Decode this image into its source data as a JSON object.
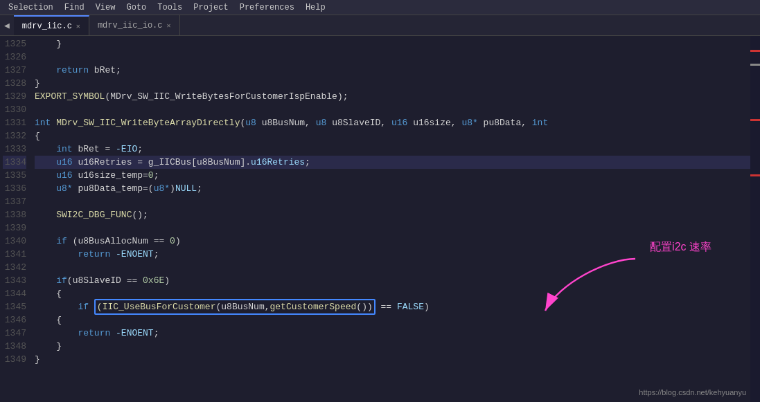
{
  "menubar": {
    "items": [
      "Selection",
      "Find",
      "View",
      "Goto",
      "Tools",
      "Project",
      "Preferences",
      "Help"
    ]
  },
  "tabs": [
    {
      "label": "mdrv_iic.c",
      "active": true
    },
    {
      "label": "mdrv_iic_io.c",
      "active": false
    }
  ],
  "lines": [
    {
      "num": "1325",
      "content": "    }",
      "tokens": [
        {
          "text": "    }",
          "class": "plain"
        }
      ]
    },
    {
      "num": "1326",
      "content": "",
      "tokens": []
    },
    {
      "num": "1327",
      "content": "    return bRet;",
      "tokens": [
        {
          "text": "    ",
          "class": "plain"
        },
        {
          "text": "return",
          "class": "kw"
        },
        {
          "text": " bRet;",
          "class": "plain"
        }
      ]
    },
    {
      "num": "1328",
      "content": "}",
      "tokens": [
        {
          "text": "}",
          "class": "plain"
        }
      ]
    },
    {
      "num": "1329",
      "content": "EXPORT_SYMBOL(MDrv_SW_IIC_WriteBytesForCustomerIspEnable);",
      "tokens": [
        {
          "text": "EXPORT_SYMBOL",
          "class": "fn"
        },
        {
          "text": "(MDrv_SW_IIC_WriteBytesForCustomerIspEnable);",
          "class": "plain"
        }
      ]
    },
    {
      "num": "1330",
      "content": "",
      "tokens": []
    },
    {
      "num": "1331",
      "content": "int MDrv_SW_IIC_WriteByteArrayDirectly(u8 u8BusNum, u8 u8SlaveID, u16 u16size, u8* pu8Data, int",
      "tokens": [
        {
          "text": "int",
          "class": "kw"
        },
        {
          "text": " ",
          "class": "plain"
        },
        {
          "text": "MDrv_SW_IIC_WriteByteArrayDirectly",
          "class": "fn"
        },
        {
          "text": "(",
          "class": "plain"
        },
        {
          "text": "u8",
          "class": "kw"
        },
        {
          "text": " u8BusNum, ",
          "class": "plain"
        },
        {
          "text": "u8",
          "class": "kw"
        },
        {
          "text": " u8SlaveID, ",
          "class": "plain"
        },
        {
          "text": "u16",
          "class": "kw"
        },
        {
          "text": " u16size, ",
          "class": "plain"
        },
        {
          "text": "u8*",
          "class": "kw"
        },
        {
          "text": " pu8Data, ",
          "class": "plain"
        },
        {
          "text": "int",
          "class": "kw"
        }
      ]
    },
    {
      "num": "1332",
      "content": "{",
      "tokens": [
        {
          "text": "{",
          "class": "plain"
        }
      ]
    },
    {
      "num": "1333",
      "content": "    int bRet = -EIO;",
      "tokens": [
        {
          "text": "    ",
          "class": "plain"
        },
        {
          "text": "int",
          "class": "kw"
        },
        {
          "text": " bRet = ",
          "class": "plain"
        },
        {
          "text": "-EIO",
          "class": "macro"
        },
        {
          "text": ";",
          "class": "plain"
        }
      ]
    },
    {
      "num": "1334",
      "content": "    u16 u16Retries = g_IICBus[u8BusNum].u16Retries;",
      "highlighted": true,
      "tokens": [
        {
          "text": "    ",
          "class": "plain"
        },
        {
          "text": "u16",
          "class": "kw"
        },
        {
          "text": " u16Retries = g_IICBus[u8BusNum].",
          "class": "plain"
        },
        {
          "text": "u16Retries",
          "class": "plain"
        },
        {
          "text": ";",
          "class": "plain"
        }
      ]
    },
    {
      "num": "1335",
      "content": "    u16 u16size_temp=0;",
      "tokens": [
        {
          "text": "    ",
          "class": "plain"
        },
        {
          "text": "u16",
          "class": "kw"
        },
        {
          "text": " u16size_temp=",
          "class": "plain"
        },
        {
          "text": "0",
          "class": "num"
        },
        {
          "text": ";",
          "class": "plain"
        }
      ]
    },
    {
      "num": "1336",
      "content": "    u8* pu8Data_temp=(u8*)NULL;",
      "tokens": [
        {
          "text": "    ",
          "class": "plain"
        },
        {
          "text": "u8*",
          "class": "kw"
        },
        {
          "text": " pu8Data_temp=(",
          "class": "plain"
        },
        {
          "text": "u8*",
          "class": "kw"
        },
        {
          "text": ")",
          "class": "plain"
        },
        {
          "text": "NULL",
          "class": "macro"
        },
        {
          "text": ";",
          "class": "plain"
        }
      ]
    },
    {
      "num": "1337",
      "content": "",
      "tokens": []
    },
    {
      "num": "1338",
      "content": "    SWI2C_DBG_FUNC();",
      "tokens": [
        {
          "text": "    ",
          "class": "plain"
        },
        {
          "text": "SWI2C_DBG_FUNC",
          "class": "fn"
        },
        {
          "text": "();",
          "class": "plain"
        }
      ]
    },
    {
      "num": "1339",
      "content": "",
      "tokens": []
    },
    {
      "num": "1340",
      "content": "    if (u8BusAllocNum == 0)",
      "tokens": [
        {
          "text": "    ",
          "class": "plain"
        },
        {
          "text": "if",
          "class": "kw"
        },
        {
          "text": " (u8BusAllocNum == ",
          "class": "plain"
        },
        {
          "text": "0",
          "class": "num"
        },
        {
          "text": ")",
          "class": "plain"
        }
      ]
    },
    {
      "num": "1341",
      "content": "        return -ENOENT;",
      "tokens": [
        {
          "text": "        ",
          "class": "plain"
        },
        {
          "text": "return",
          "class": "kw"
        },
        {
          "text": " ",
          "class": "plain"
        },
        {
          "text": "-ENOENT",
          "class": "macro"
        },
        {
          "text": ";",
          "class": "plain"
        }
      ]
    },
    {
      "num": "1342",
      "content": "",
      "tokens": []
    },
    {
      "num": "1343",
      "content": "    if(u8SlaveID == 0x6E)",
      "tokens": [
        {
          "text": "    ",
          "class": "plain"
        },
        {
          "text": "if",
          "class": "kw"
        },
        {
          "text": "(u8SlaveID == ",
          "class": "plain"
        },
        {
          "text": "0x6E",
          "class": "num"
        },
        {
          "text": ")",
          "class": "plain"
        }
      ]
    },
    {
      "num": "1344",
      "content": "    {",
      "tokens": [
        {
          "text": "    {",
          "class": "plain"
        }
      ]
    },
    {
      "num": "1345",
      "content": "        if (IIC_UseBusForCustomer(u8BusNum,getCustomerSpeed()) == FALSE)",
      "special": "selection",
      "tokens": [
        {
          "text": "        ",
          "class": "plain"
        },
        {
          "text": "if",
          "class": "kw"
        },
        {
          "text": " ",
          "class": "plain"
        },
        {
          "text": "(IIC_UseBusForCustomer(u8BusNum,getCustomerSpeed())",
          "class": "selection-content"
        },
        {
          "text": " == ",
          "class": "plain"
        },
        {
          "text": "FALSE",
          "class": "false-color"
        },
        {
          "text": ")",
          "class": "plain"
        }
      ]
    },
    {
      "num": "1346",
      "content": "    {",
      "tokens": [
        {
          "text": "    {",
          "class": "plain"
        }
      ]
    },
    {
      "num": "1347",
      "content": "        return -ENOENT;",
      "tokens": [
        {
          "text": "        ",
          "class": "plain"
        },
        {
          "text": "return",
          "class": "kw"
        },
        {
          "text": " ",
          "class": "plain"
        },
        {
          "text": "-ENOENT",
          "class": "macro"
        },
        {
          "text": ";",
          "class": "plain"
        }
      ]
    },
    {
      "num": "1348",
      "content": "    }",
      "tokens": [
        {
          "text": "    }",
          "class": "plain"
        }
      ]
    },
    {
      "num": "1349",
      "content": "}",
      "tokens": [
        {
          "text": "}",
          "class": "plain"
        }
      ]
    }
  ],
  "annotation": {
    "text": "配置i2c 速率"
  },
  "watermark": "https://blog.csdn.net/kehyuanyu"
}
